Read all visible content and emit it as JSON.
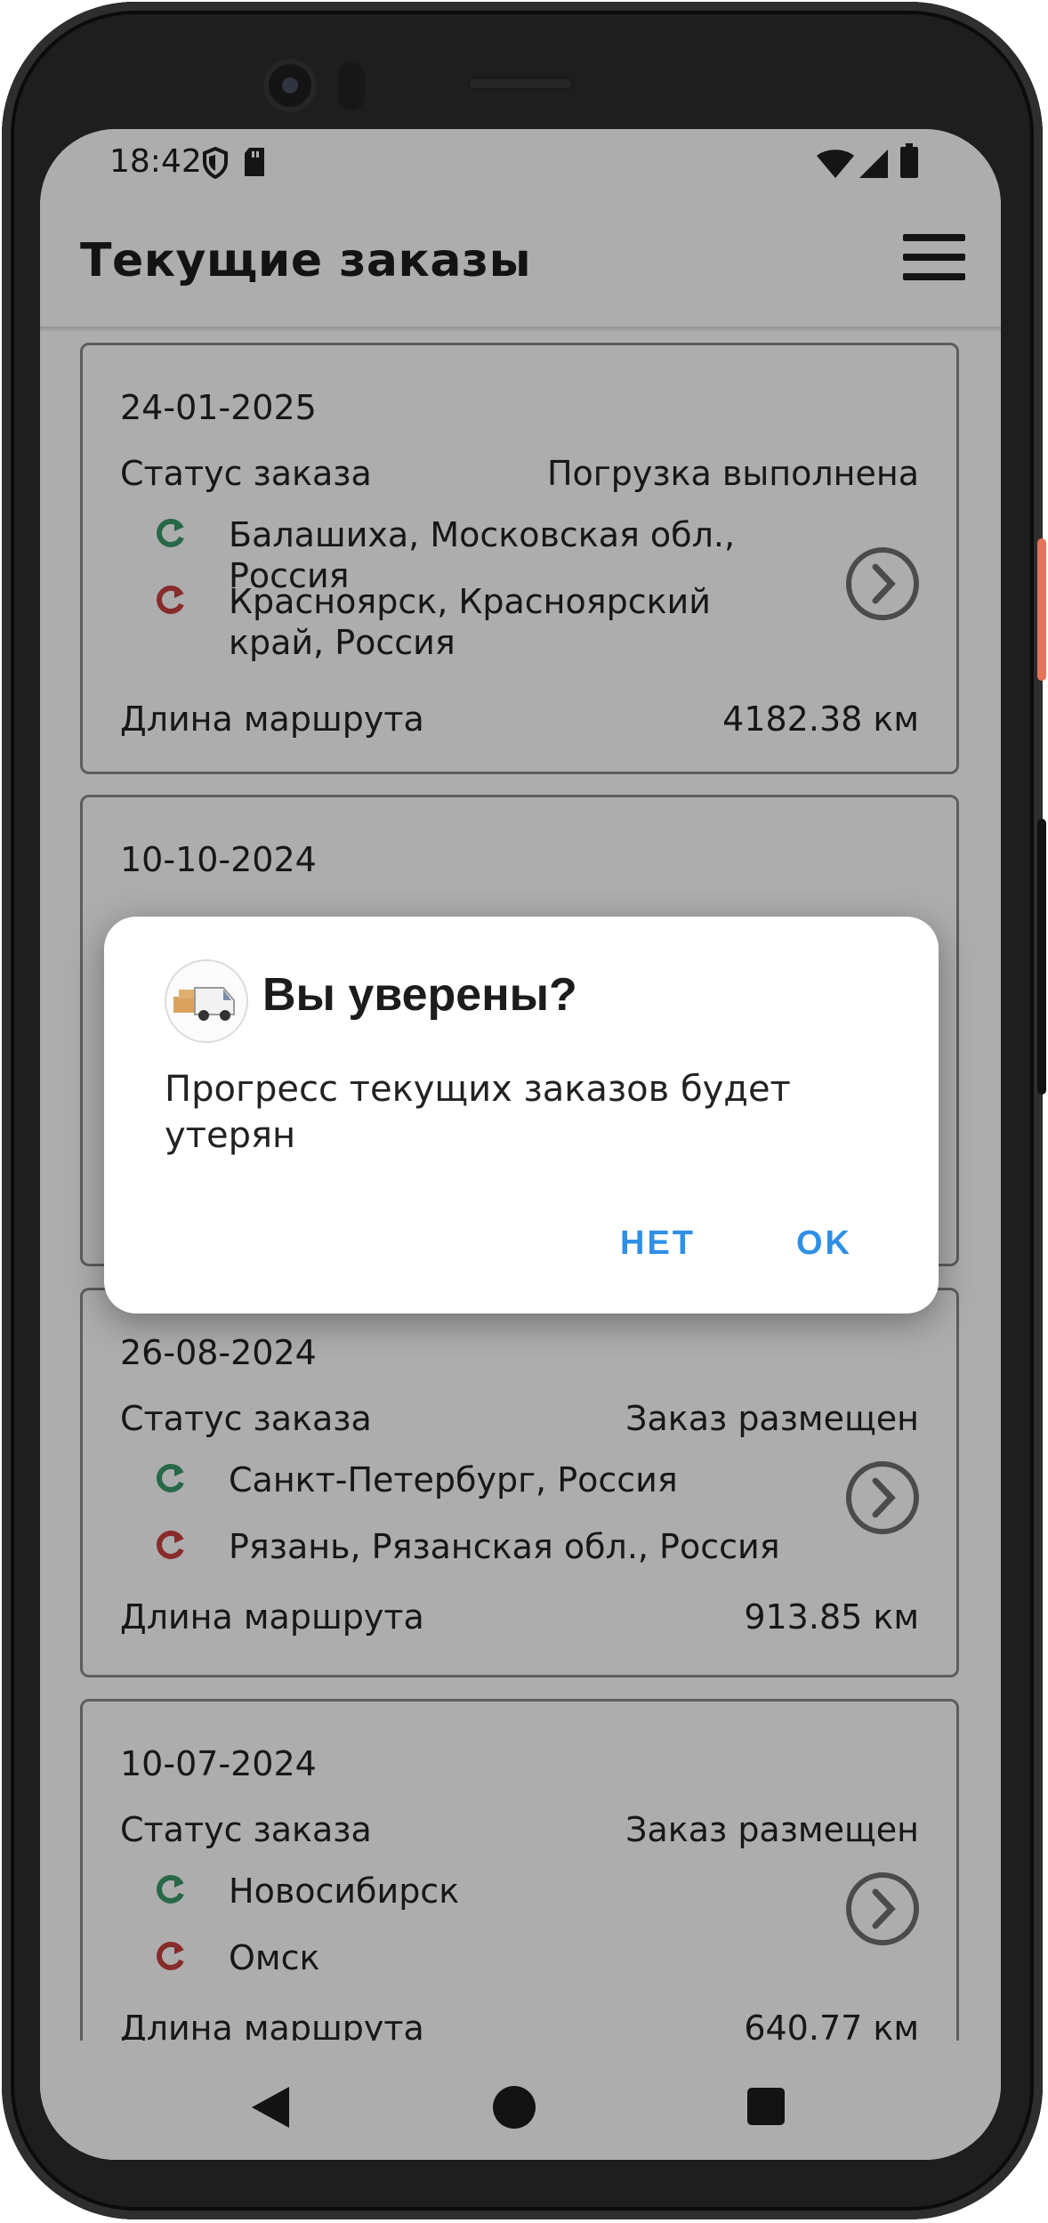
{
  "status_bar": {
    "time": "18:42",
    "left_icons": [
      "shield-icon",
      "sd-card-icon"
    ],
    "right_icons": [
      "wifi-icon",
      "cellular-signal-icon",
      "battery-icon"
    ]
  },
  "app_bar": {
    "title": "Текущие заказы",
    "menu_icon": "hamburger-menu-icon"
  },
  "orders": [
    {
      "date": "24-01-2025",
      "status_label": "Статус заказа",
      "status": "Погрузка выполнена",
      "from": "Балашиха, Московская обл., Россия",
      "to": "Красноярск, Красноярский край, Россия",
      "length_label": "Длина маршрута",
      "length": "4182.38 км"
    },
    {
      "date": "10-10-2024"
    },
    {
      "date": "26-08-2024",
      "status_label": "Статус заказа",
      "status": "Заказ размещен",
      "from": "Санкт-Петербург, Россия",
      "to": "Рязань, Рязанская обл., Россия",
      "length_label": "Длина маршрута",
      "length": "913.85 км"
    },
    {
      "date": "10-07-2024",
      "status_label": "Статус заказа",
      "status": "Заказ размещен",
      "from": "Новосибирск",
      "to": "Омск",
      "length_label": "Длина маршрута",
      "length": "640.77 км"
    }
  ],
  "icons": {
    "from": "origin-marker-icon",
    "to": "destination-marker-icon",
    "open": "chevron-right-circle-icon"
  },
  "colors": {
    "origin": "#3a9a6a",
    "destination": "#c94040",
    "accent": "#2f8fe6"
  },
  "dialog": {
    "logo_icon": "delivery-van-logo-icon",
    "title": "Вы уверены?",
    "message": "Прогресс текущих заказов будет утерян",
    "cancel_label": "НЕТ",
    "ok_label": "OK"
  },
  "nav_bar": {
    "back_icon": "back-triangle-icon",
    "home_icon": "home-circle-icon",
    "recents_icon": "recents-square-icon"
  }
}
